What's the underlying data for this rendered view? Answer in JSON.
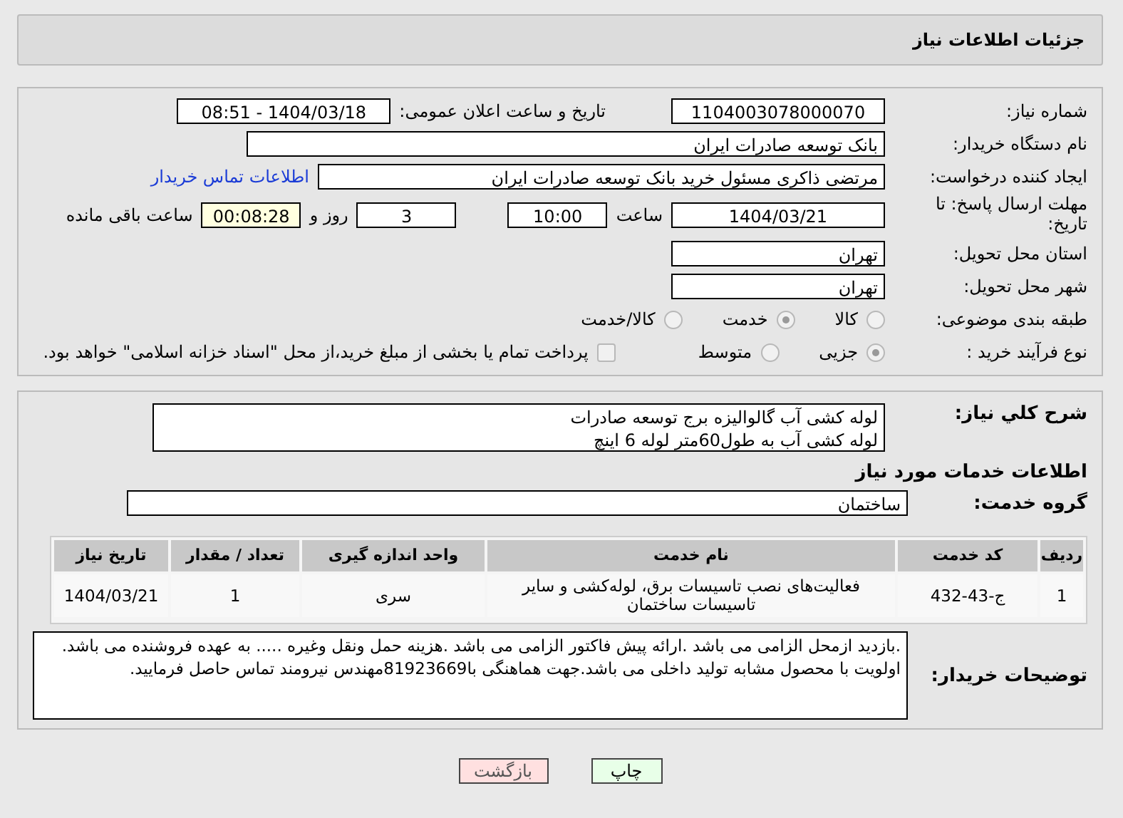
{
  "header": {
    "title": "جزئیات اطلاعات نیاز"
  },
  "fields": {
    "need_number": {
      "label": "شماره نیاز:",
      "value": "1104003078000070"
    },
    "announce": {
      "label": "تاریخ و ساعت اعلان عمومی:",
      "value": "1404/03/18 - 08:51"
    },
    "buyer": {
      "label": "نام دستگاه خریدار:",
      "value": "بانک توسعه صادرات ایران"
    },
    "creator": {
      "label": "ایجاد کننده درخواست:",
      "value": "مرتضی ذاکری مسئول خرید بانک توسعه صادرات ایران",
      "link": "اطلاعات تماس خریدار"
    },
    "deadline": {
      "label": "مهلت ارسال پاسخ: تا تاریخ:",
      "date": "1404/03/21",
      "time_label": "ساعت",
      "time": "10:00",
      "days": "3",
      "days_label": "روز و",
      "remaining": "00:08:28",
      "remaining_label": "ساعت باقی مانده"
    },
    "province": {
      "label": "استان محل تحویل:",
      "value": "تهران"
    },
    "city": {
      "label": "شهر محل تحویل:",
      "value": "تهران"
    }
  },
  "category": {
    "label": "طبقه بندی موضوعی:",
    "options": [
      {
        "label": "کالا",
        "selected": false
      },
      {
        "label": "خدمت",
        "selected": true
      },
      {
        "label": "کالا/خدمت",
        "selected": false
      }
    ]
  },
  "process": {
    "label": "نوع فرآیند خرید :",
    "options": [
      {
        "label": "جزیی",
        "selected": true
      },
      {
        "label": "متوسط",
        "selected": false
      }
    ],
    "payment": {
      "checked": false,
      "text": "پرداخت تمام یا بخشی از مبلغ خرید،از محل \"اسناد خزانه اسلامی\" خواهد بود."
    }
  },
  "description": {
    "label": "شرح کلي نیاز:",
    "lines": [
      "لوله کشی آب گالوالیزه برج توسعه صادرات",
      "لوله کشی آب به طول60متر لوله 6 اینچ"
    ]
  },
  "services_heading": "اطلاعات خدمات مورد نیاز",
  "service_group": {
    "label": "گروه خدمت:",
    "value": "ساختمان"
  },
  "table": {
    "columns": [
      "ردیف",
      "کد خدمت",
      "نام خدمت",
      "واحد اندازه گیری",
      "تعداد / مقدار",
      "تاریخ نیاز"
    ],
    "rows": [
      [
        "1",
        "ج-43-432",
        "فعالیت‌های نصب تاسیسات برق، لوله‌کشی و سایر تاسیسات ساختمان",
        "سری",
        "1",
        "1404/03/21"
      ]
    ]
  },
  "notes": {
    "label": "توضیحات خریدار:",
    "lines": [
      ".بازدید ازمحل الزامی می باشد .ارائه پیش فاکتور الزامی می باشد .هزینه حمل ونقل وغیره ..... به عهده فروشنده می باشد.",
      "اولویت با محصول مشابه تولید داخلی می باشد.جهت هماهنگی با81923669مهندس نیرومند تماس حاصل فرمایید."
    ]
  },
  "buttons": [
    {
      "label": "چاپ",
      "kind": "print"
    },
    {
      "label": "بازگشت",
      "kind": "back"
    }
  ]
}
